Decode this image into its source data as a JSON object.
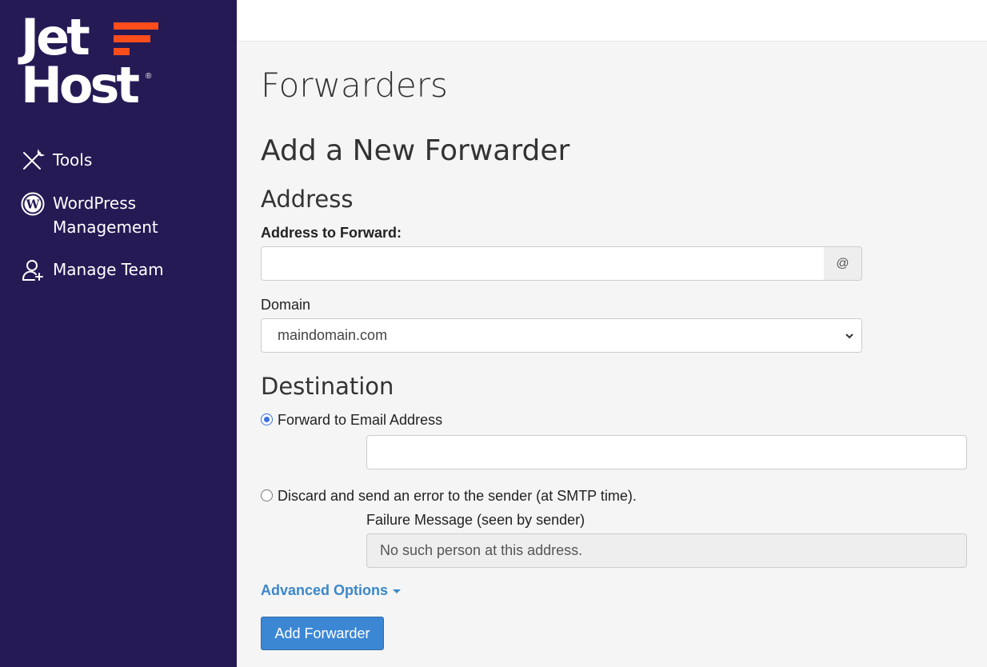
{
  "brand": {
    "line1": "Jet",
    "line2": "Host",
    "registered": "®",
    "accent": "#ff4d1c",
    "sidebar_bg": "#261a55"
  },
  "sidebar": {
    "items": [
      {
        "label": "Tools",
        "icon": "tools-icon"
      },
      {
        "label": "WordPress Management",
        "icon": "wordpress-icon"
      },
      {
        "label": "Manage Team",
        "icon": "add-user-icon"
      }
    ]
  },
  "main": {
    "title": "Forwarders",
    "subtitle": "Add a New Forwarder",
    "address": {
      "heading": "Address",
      "forward_label": "Address to Forward:",
      "forward_value": "",
      "at_symbol": "@",
      "domain_label": "Domain",
      "domain_value": "maindomain.com"
    },
    "destination": {
      "heading": "Destination",
      "forward_email_label": "Forward to Email Address",
      "forward_email_selected": true,
      "forward_email_value": "",
      "discard_label": "Discard and send an error to the sender (at SMTP time).",
      "discard_selected": false,
      "failure_label": "Failure Message (seen by sender)",
      "failure_value": "No such person at this address."
    },
    "advanced_options": "Advanced Options",
    "submit": "Add Forwarder"
  }
}
